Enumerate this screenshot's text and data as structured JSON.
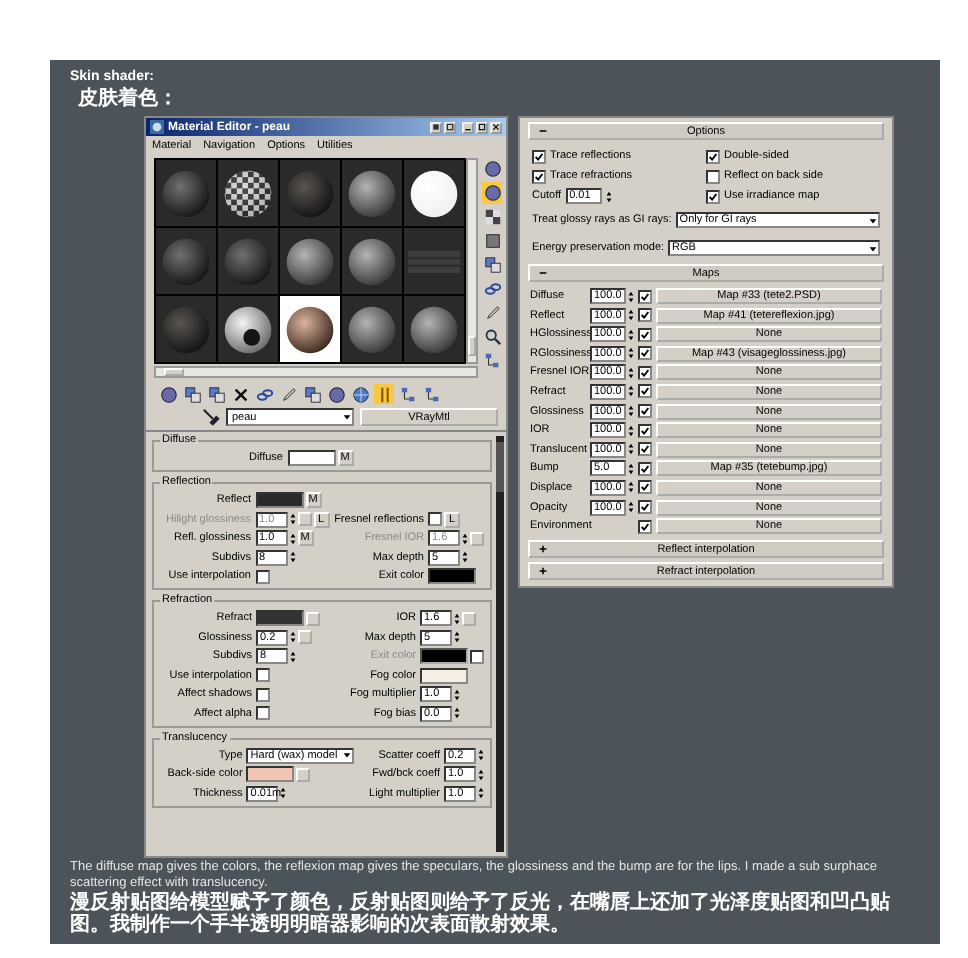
{
  "heading": {
    "title": "Skin shader:",
    "subtitle": "皮肤着色："
  },
  "material_editor": {
    "title": "Material Editor - peau",
    "menu": [
      "Material",
      "Navigation",
      "Options",
      "Utilities"
    ],
    "sample_slots": [
      {
        "kind": "dark",
        "selected": false
      },
      {
        "kind": "checker",
        "selected": false
      },
      {
        "kind": "noisy",
        "selected": false
      },
      {
        "kind": "grey",
        "selected": false
      },
      {
        "kind": "white",
        "selected": false
      },
      {
        "kind": "dark",
        "selected": false
      },
      {
        "kind": "dark",
        "selected": false
      },
      {
        "kind": "grey",
        "selected": false
      },
      {
        "kind": "grey",
        "selected": false
      },
      {
        "kind": "flat",
        "selected": false
      },
      {
        "kind": "noisy",
        "selected": false
      },
      {
        "kind": "eye",
        "selected": false
      },
      {
        "kind": "skin",
        "selected": true
      },
      {
        "kind": "grey",
        "selected": false
      },
      {
        "kind": "grey",
        "selected": false
      }
    ],
    "side_tools": [
      {
        "kind": "sphere",
        "selected": false
      },
      {
        "kind": "sphere",
        "selected": true
      },
      {
        "kind": "checker",
        "selected": false
      },
      {
        "kind": "box",
        "selected": false
      },
      {
        "kind": "copy",
        "selected": false
      },
      {
        "kind": "chain",
        "selected": false
      },
      {
        "kind": "pencil",
        "selected": false
      },
      {
        "kind": "magnifier",
        "selected": false
      },
      {
        "kind": "tree",
        "selected": false
      }
    ],
    "bottom_tools": [
      {
        "kind": "sphere",
        "selected": false
      },
      {
        "kind": "copy",
        "selected": false
      },
      {
        "kind": "copy",
        "selected": false
      },
      {
        "kind": "cross",
        "selected": false
      },
      {
        "kind": "chain",
        "selected": false
      },
      {
        "kind": "pencil",
        "selected": false
      },
      {
        "kind": "copy",
        "selected": false
      },
      {
        "kind": "sphere",
        "selected": false
      },
      {
        "kind": "globe",
        "selected": false
      },
      {
        "kind": "bars",
        "selected": true
      },
      {
        "kind": "tree",
        "selected": false
      },
      {
        "kind": "tree",
        "selected": false
      }
    ],
    "material_name": "peau",
    "material_type": "VRayMtl",
    "rollouts": [
      {
        "title": "Diffuse",
        "rows": [
          {
            "left": {
              "kind": "color",
              "label": "Diffuse",
              "color": "#ffffff",
              "button": "M"
            }
          }
        ]
      },
      {
        "title": "Reflection",
        "rows": [
          {
            "left": {
              "kind": "color",
              "label": "Reflect",
              "color": "#2a2a2a",
              "button": "M"
            }
          },
          {
            "left": {
              "kind": "spinner",
              "label": "Hilight glossiness",
              "value": "1.0",
              "disabled": true,
              "blank_button": true,
              "button": "L"
            },
            "right": {
              "kind": "checkbox",
              "label": "Fresnel reflections",
              "checked": false,
              "button": "L"
            }
          },
          {
            "left": {
              "kind": "spinner",
              "label": "Refl. glossiness",
              "value": "1.0",
              "button": "M"
            },
            "right": {
              "kind": "spinner",
              "label": "Fresnel IOR",
              "value": "1.6",
              "disabled": true,
              "blank_button": true
            }
          },
          {
            "left": {
              "kind": "spinner",
              "label": "Subdivs",
              "value": "8"
            },
            "right": {
              "kind": "spinner",
              "label": "Max depth",
              "value": "5"
            }
          },
          {
            "left": {
              "kind": "checkbox",
              "label": "Use interpolation",
              "checked": false
            },
            "right": {
              "kind": "color",
              "label": "Exit color",
              "color": "#000000"
            }
          }
        ]
      },
      {
        "title": "Refraction",
        "rows": [
          {
            "left": {
              "kind": "color",
              "label": "Refract",
              "color": "#333333",
              "blank_button": true
            },
            "right": {
              "kind": "spinner",
              "label": "IOR",
              "value": "1.6",
              "blank_button": true
            }
          },
          {
            "left": {
              "kind": "spinner",
              "label": "Glossiness",
              "value": "0.2",
              "blank_button": true
            },
            "right": {
              "kind": "spinner",
              "label": "Max depth",
              "value": "5"
            }
          },
          {
            "left": {
              "kind": "spinner",
              "label": "Subdivs",
              "value": "8"
            },
            "right": {
              "kind": "color",
              "label": "Exit color",
              "color": "#000000",
              "disabled": true,
              "checked": false
            }
          },
          {
            "left": {
              "kind": "checkbox",
              "label": "Use interpolation",
              "checked": false
            },
            "right": {
              "kind": "color",
              "label": "Fog color",
              "color": "#f6efe4"
            }
          },
          {
            "left": {
              "kind": "checkbox",
              "label": "Affect shadows",
              "checked": false
            },
            "right": {
              "kind": "spinner",
              "label": "Fog multiplier",
              "value": "1.0"
            }
          },
          {
            "left": {
              "kind": "checkbox",
              "label": "Affect alpha",
              "checked": false
            },
            "right": {
              "kind": "spinner",
              "label": "Fog bias",
              "value": "0.0"
            }
          }
        ]
      },
      {
        "title": "Translucency",
        "rows": [
          {
            "left": {
              "kind": "dropdown",
              "label": "Type",
              "value": "Hard (wax) model"
            },
            "right": {
              "kind": "spinner",
              "label": "Scatter coeff",
              "value": "0.2"
            }
          },
          {
            "left": {
              "kind": "color",
              "label": "Back-side color",
              "color": "#f2c4b4",
              "blank_button": true
            },
            "right": {
              "kind": "spinner",
              "label": "Fwd/bck coeff",
              "value": "1.0"
            }
          },
          {
            "left": {
              "kind": "spinner",
              "label": "Thickness",
              "value": "0.01m"
            },
            "right": {
              "kind": "spinner",
              "label": "Light multiplier",
              "value": "1.0"
            }
          }
        ]
      }
    ]
  },
  "parameter_panel": {
    "rollouts": [
      {
        "kind": "options",
        "title": "Options",
        "expanded": true,
        "left": [
          {
            "kind": "checkbox",
            "label": "Trace reflections",
            "checked": true
          },
          {
            "kind": "checkbox",
            "label": "Trace refractions",
            "checked": true
          },
          {
            "kind": "spinner",
            "label": "Cutoff",
            "value": "0.01"
          }
        ],
        "right": [
          {
            "kind": "checkbox",
            "label": "Double-sided",
            "checked": true
          },
          {
            "kind": "checkbox",
            "label": "Reflect on back side",
            "checked": false
          },
          {
            "kind": "checkbox",
            "label": "Use irradiance map",
            "checked": true
          }
        ],
        "dropdowns": [
          {
            "label": "Treat glossy rays as GI rays:",
            "value": "Only for GI rays"
          },
          {
            "label": "Energy preservation mode:",
            "value": "RGB"
          }
        ]
      },
      {
        "kind": "maps",
        "title": "Maps",
        "expanded": true,
        "rows": [
          {
            "name": "Diffuse",
            "amount": "100.0",
            "checked": true,
            "map": "Map #33 (tete2.PSD)"
          },
          {
            "name": "Reflect",
            "amount": "100.0",
            "checked": true,
            "map": "Map #41 (tetereflexion.jpg)"
          },
          {
            "name": "HGlossiness",
            "amount": "100.0",
            "checked": true,
            "map": "None"
          },
          {
            "name": "RGlossiness",
            "amount": "100.0",
            "checked": true,
            "map": "Map #43 (visageglossiness.jpg)"
          },
          {
            "name": "Fresnel IOR",
            "amount": "100.0",
            "checked": true,
            "map": "None"
          },
          {
            "name": "Refract",
            "amount": "100.0",
            "checked": true,
            "map": "None"
          },
          {
            "name": "Glossiness",
            "amount": "100.0",
            "checked": true,
            "map": "None"
          },
          {
            "name": "IOR",
            "amount": "100.0",
            "checked": true,
            "map": "None"
          },
          {
            "name": "Translucent",
            "amount": "100.0",
            "checked": true,
            "map": "None"
          },
          {
            "name": "Bump",
            "amount": "5.0",
            "checked": true,
            "map": "Map #35 (tetebump.jpg)"
          },
          {
            "name": "Displace",
            "amount": "100.0",
            "checked": true,
            "map": "None"
          },
          {
            "name": "Opacity",
            "amount": "100.0",
            "checked": true,
            "map": "None"
          },
          {
            "name": "Environment",
            "checked": true,
            "map": "None"
          }
        ]
      },
      {
        "kind": "plain",
        "title": "Reflect interpolation",
        "expanded": false
      },
      {
        "kind": "plain",
        "title": "Refract interpolation",
        "expanded": false
      }
    ]
  },
  "caption": {
    "english": "The diffuse map gives the colors, the reflexion map gives the speculars, the glossiness and the bump are for the lips. I made a sub surphace scattering effect with translucency.",
    "chinese": "漫反射贴图给模型赋予了颜色，反射贴图则给予了反光，在嘴唇上还加了光泽度贴图和凹凸贴图。我制作一个手半透明明暗器影响的次表面散射效果。"
  }
}
